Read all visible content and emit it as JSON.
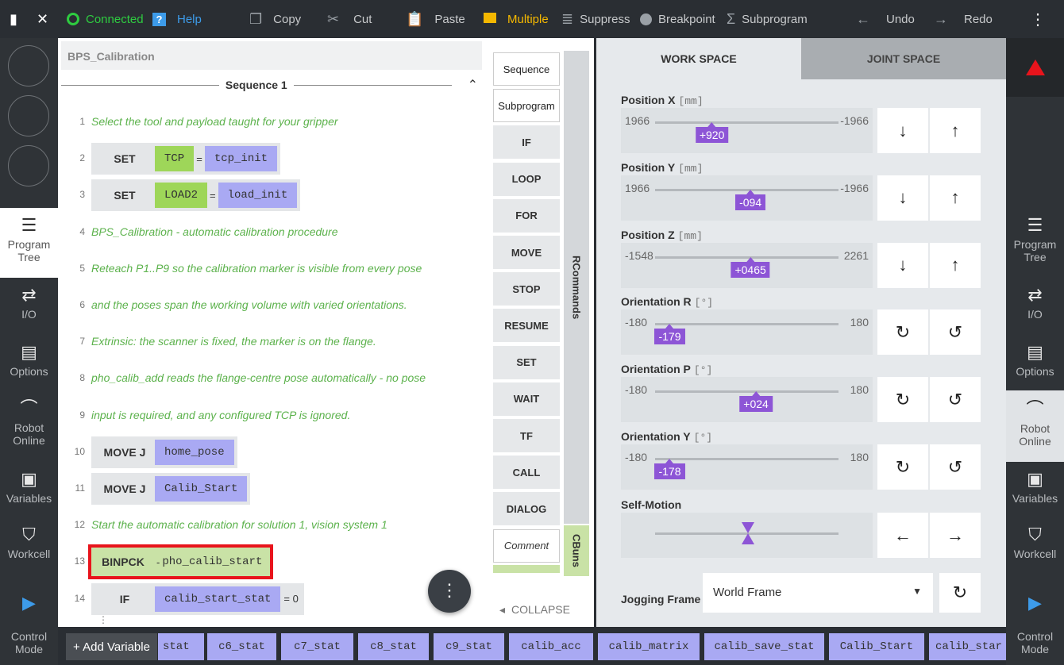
{
  "topbar": {
    "connected": "Connected",
    "help": "Help",
    "copy": "Copy",
    "cut": "Cut",
    "paste": "Paste",
    "multiple": "Multiple",
    "suppress": "Suppress",
    "breakpoint": "Breakpoint",
    "subprogram": "Subprogram",
    "undo": "Undo",
    "redo": "Redo"
  },
  "nav": {
    "program_tree": "Program Tree",
    "io": "I/O",
    "options": "Options",
    "robot_online": "Robot Online",
    "variables": "Variables",
    "workcell": "Workcell",
    "control_mode": "Control Mode"
  },
  "editor": {
    "program_name": "BPS_Calibration",
    "sequence": "Sequence 1",
    "lines": [
      {
        "n": "1",
        "text": "Select the tool and payload taught for your gripper"
      },
      {
        "n": "2",
        "kw": "SET",
        "a": "TCP",
        "op": "=",
        "b": "tcp_init"
      },
      {
        "n": "3",
        "kw": "SET",
        "a": "LOAD2",
        "op": "=",
        "b": "load_init"
      },
      {
        "n": "4",
        "text": "BPS_Calibration - automatic calibration procedure"
      },
      {
        "n": "5",
        "text": "Reteach P1..P9 so the calibration marker is visible from every pose"
      },
      {
        "n": "6",
        "text": "and the poses span the working volume with varied orientations."
      },
      {
        "n": "7",
        "text": "Extrinsic: the scanner is fixed, the marker is on the flange."
      },
      {
        "n": "8",
        "text": "pho_calib_add reads the flange-centre pose automatically - no pose"
      },
      {
        "n": "9",
        "text": "input is required, and any configured TCP is ignored."
      },
      {
        "n": "10",
        "kw": "MOVE J",
        "b": "home_pose"
      },
      {
        "n": "11",
        "kw": "MOVE J",
        "b": "Calib_Start"
      },
      {
        "n": "12",
        "text": "Start the automatic calibration for solution 1, vision system 1"
      },
      {
        "n": "13",
        "kw": "BINPCK",
        "op": "-",
        "b": "pho_calib_start"
      },
      {
        "n": "14",
        "kw": "IF",
        "b": "calib_start_stat",
        "op2": "= 0"
      }
    ]
  },
  "palette": {
    "buttons": [
      "Sequence",
      "Subprogram",
      "IF",
      "LOOP",
      "FOR",
      "MOVE",
      "STOP",
      "RESUME",
      "SET",
      "WAIT",
      "TF",
      "CALL",
      "DIALOG",
      "Comment"
    ],
    "tab_rcommands": "RCommands",
    "tab_cbuns": "CBuns",
    "collapse": "COLLAPSE"
  },
  "jog": {
    "tab_work": "WORK SPACE",
    "tab_joint": "JOINT SPACE",
    "axes": [
      {
        "label": "Position X",
        "unit": "[mm]",
        "min": "1966",
        "max": "-1966",
        "value": "+920",
        "frac": 0.31
      },
      {
        "label": "Position Y",
        "unit": "[mm]",
        "min": "1966",
        "max": "-1966",
        "value": "-094",
        "frac": 0.52
      },
      {
        "label": "Position Z",
        "unit": "[mm]",
        "min": "-1548",
        "max": "2261",
        "value": "+0465",
        "frac": 0.52
      },
      {
        "label": "Orientation R",
        "unit": "[°]",
        "min": "-180",
        "max": "180",
        "value": "-179",
        "frac": 0.08
      },
      {
        "label": "Orientation P",
        "unit": "[°]",
        "min": "-180",
        "max": "180",
        "value": "+024",
        "frac": 0.55
      },
      {
        "label": "Orientation Y",
        "unit": "[°]",
        "min": "-180",
        "max": "180",
        "value": "-178",
        "frac": 0.08
      }
    ],
    "self_motion": "Self-Motion",
    "jogging_frame": "Jogging Frame",
    "frame_value": "World Frame"
  },
  "bottombar": {
    "add_variable": "+ Add Variable",
    "variables": [
      "stat",
      "c6_stat",
      "c7_stat",
      "c8_stat",
      "c9_stat",
      "calib_acc",
      "calib_matrix",
      "calib_save_stat",
      "Calib_Start",
      "calib_star"
    ]
  },
  "colors": {
    "accent": "#8d55d6",
    "chip_purple": "#a9a9f3",
    "chip_green": "#9ed659",
    "comment": "#5cb24c",
    "connected": "#2ecc40",
    "multiple": "#f5b800",
    "highlight": "#e8141c"
  }
}
